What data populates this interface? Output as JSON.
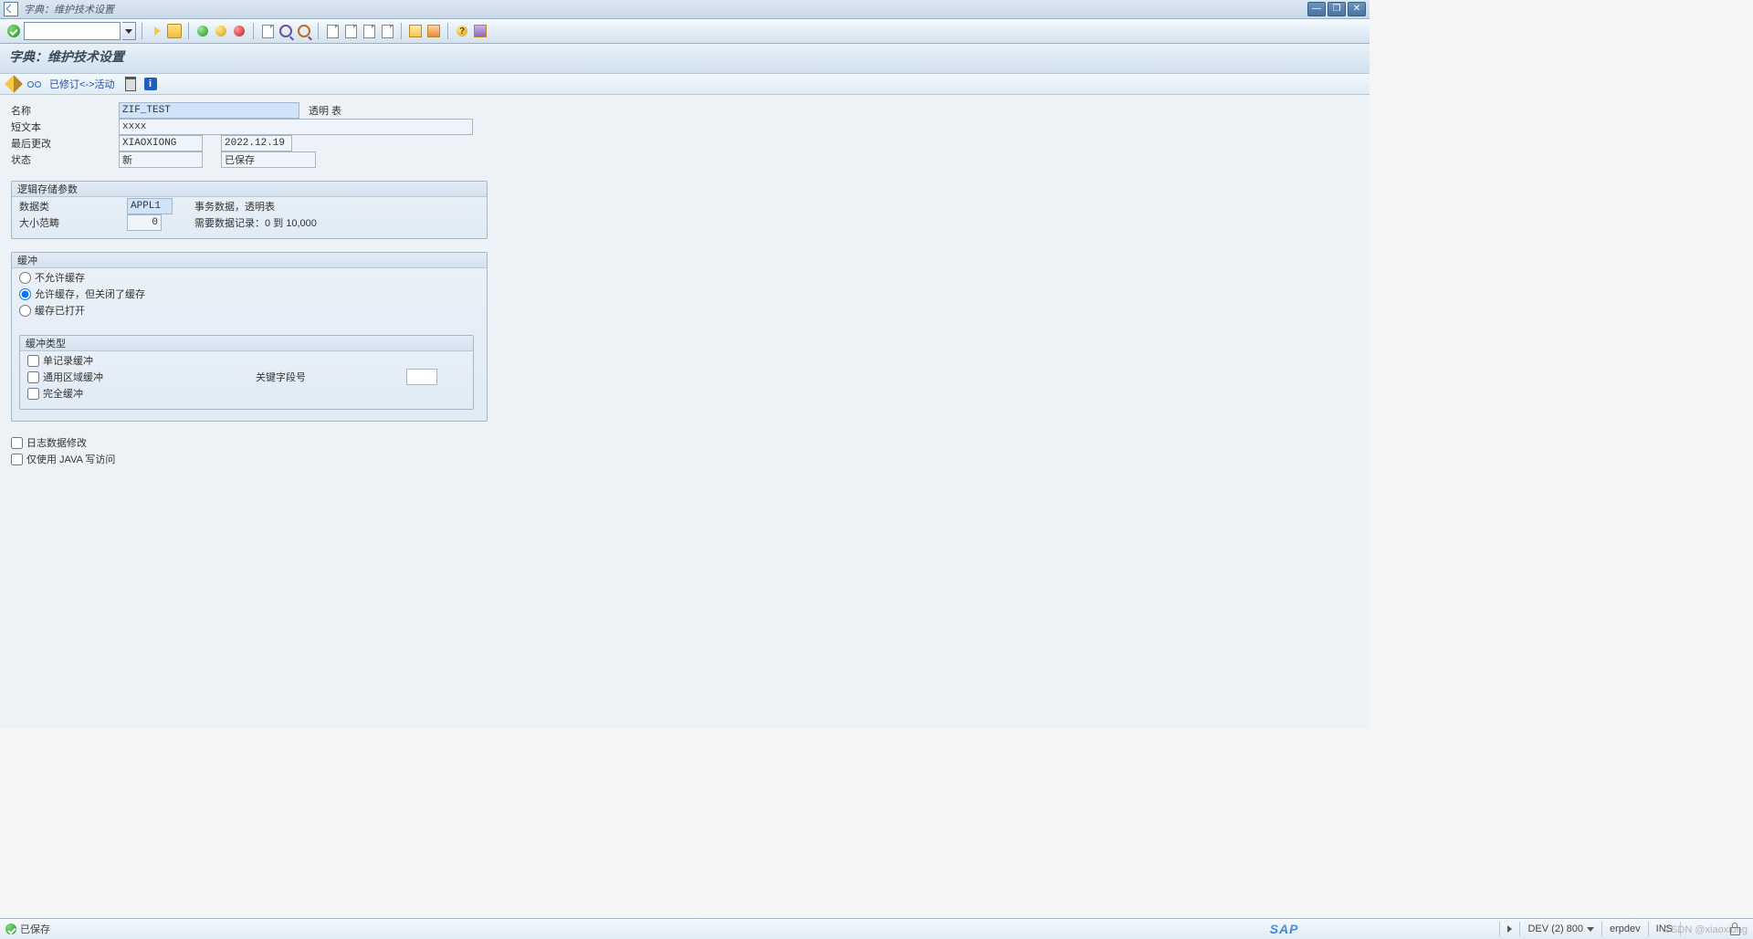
{
  "window": {
    "title": "字典：维护技术设置"
  },
  "heading": "字典：维护技术设置",
  "subtoolbar": {
    "revised_active": "已修订<->活动"
  },
  "header": {
    "name_lbl": "名称",
    "name_val": "ZIF_TEST",
    "name_side": "透明 表",
    "short_lbl": "短文本",
    "short_val": "xxxx",
    "lastchg_lbl": "最后更改",
    "lastchg_user": "XIAOXIONG",
    "lastchg_date": "2022.12.19",
    "status_lbl": "状态",
    "status_val": "新",
    "status_save": "已保存"
  },
  "logical": {
    "title": "逻辑存储参数",
    "dataclass_lbl": "数据类",
    "dataclass_val": "APPL1",
    "dataclass_side": "事务数据，透明表",
    "size_lbl": "大小范畴",
    "size_val": "0",
    "size_side": "需要数据记录：0 到 10,000"
  },
  "buffer": {
    "title": "缓冲",
    "r1": "不允许缓存",
    "r2": "允许缓存，但关闭了缓存",
    "r3": "缓存已打开",
    "type_title": "缓冲类型",
    "c1": "单记录缓冲",
    "c2": "通用区域缓冲",
    "c3": "完全缓冲",
    "key_lbl": "关键字段号"
  },
  "other": {
    "log": "日志数据修改",
    "java": "仅使用 JAVA 写访问"
  },
  "status": {
    "msg": "已保存",
    "sap": "SAP",
    "sys": "DEV (2) 800",
    "srv": "erpdev",
    "ins": "INS"
  },
  "watermark": "CSDN @xiaoxiong"
}
